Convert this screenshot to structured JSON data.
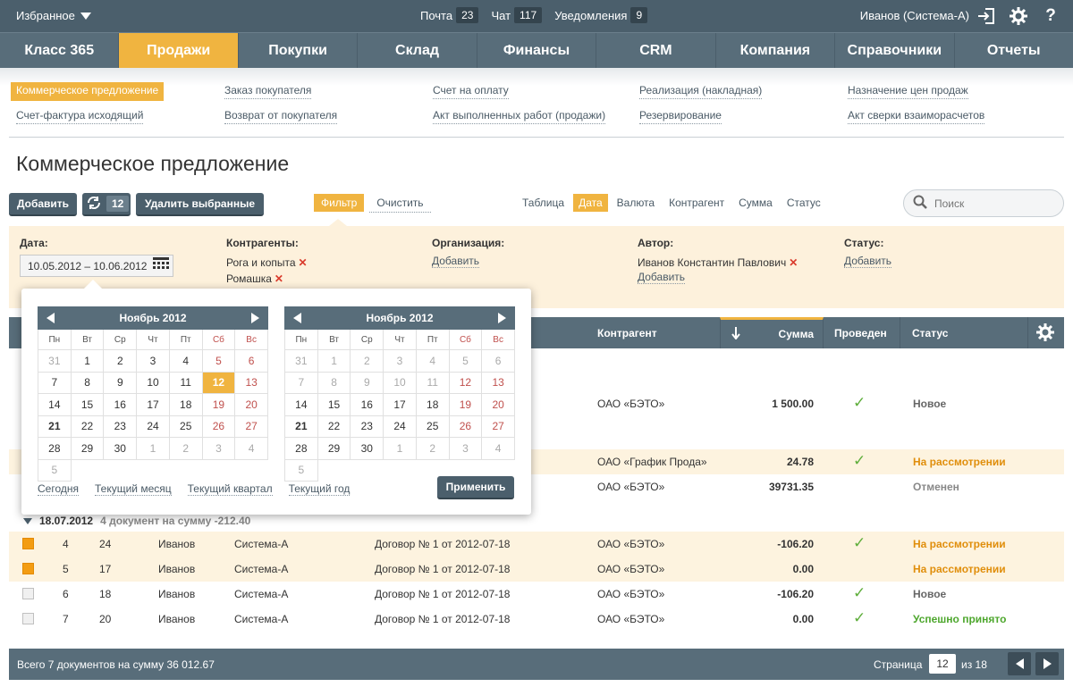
{
  "topbar": {
    "favorites": "Избранное",
    "mail_label": "Почта",
    "mail_count": "23",
    "chat_label": "Чат",
    "chat_count": "117",
    "notif_label": "Уведомления",
    "notif_count": "9",
    "user": "Иванов (Система-А)"
  },
  "nav": [
    "Класс 365",
    "Продажи",
    "Покупки",
    "Склад",
    "Финансы",
    "CRM",
    "Компания",
    "Справочники",
    "Отчеты"
  ],
  "subnav": [
    [
      "Коммерческое предложение",
      "Счет-фактура исходящий"
    ],
    [
      "Заказ покупателя",
      "Возврат от покупателя"
    ],
    [
      "Счет на оплату",
      "Акт выполненных работ (продажи)"
    ],
    [
      "Реализация (накладная)",
      "Резервирование"
    ],
    [
      "Назначение цен продаж",
      "Акт сверки взаиморасчетов"
    ]
  ],
  "page_title": "Коммерческое предложение",
  "toolbar": {
    "add": "Добавить",
    "refresh_count": "12",
    "delete": "Удалить выбранные"
  },
  "filter_tabs": {
    "filter": "Фильтр",
    "clear": "Очистить"
  },
  "view_tabs": [
    "Таблица",
    "Дата",
    "Валюта",
    "Контрагент",
    "Сумма",
    "Статус"
  ],
  "search": {
    "placeholder": "Поиск"
  },
  "filters": {
    "date_label": "Дата:",
    "date_value": "10.05.2012 – 10.06.2012",
    "contractors_label": "Контрагенты:",
    "contractor1": "Рога и копыта",
    "contractor2": "Ромашка",
    "org_label": "Организация:",
    "org_add": "Добавить",
    "author_label": "Автор:",
    "author_value": "Иванов Константин Павлович",
    "author_add": "Добавить",
    "status_label": "Статус:",
    "status_add": "Добавить"
  },
  "table_headers": {
    "contractor": "Контрагент",
    "sum": "Сумма",
    "posted": "Проведен",
    "status": "Статус"
  },
  "upper_rows": [
    {
      "contractor": "ОАО «БЭТО»",
      "sum": "1 500.00",
      "check": "✓",
      "status": "Новое"
    },
    {
      "contractor": "ОАО «График Прода»",
      "sum": "24.78",
      "check": "✓",
      "status": "На рассмотрении"
    },
    {
      "contractor": "ОАО «БЭТО»",
      "sum": "39731.35",
      "check": "",
      "status": "Отменен"
    }
  ],
  "group": {
    "date": "18.07.2012",
    "summary": "4 документ на сумму -212.40"
  },
  "rows": [
    {
      "n": "4",
      "num": "24",
      "author": "Иванов",
      "org": "Система-А",
      "contract": "Договор № 1 от 2012-07-18",
      "contractor": "ОАО «БЭТО»",
      "sum": "-106.20",
      "check": "✓",
      "status": "На рассмотрении"
    },
    {
      "n": "5",
      "num": "17",
      "author": "Иванов",
      "org": "Система-А",
      "contract": "Договор № 1 от 2012-07-18",
      "contractor": "ОАО «БЭТО»",
      "sum": "0.00",
      "check": "",
      "status": "На рассмотрении"
    },
    {
      "n": "6",
      "num": "18",
      "author": "Иванов",
      "org": "Система-А",
      "contract": "Договор № 1 от 2012-07-18",
      "contractor": "ОАО «БЭТО»",
      "sum": "-106.20",
      "check": "✓",
      "status": "Новое"
    },
    {
      "n": "7",
      "num": "20",
      "author": "Иванов",
      "org": "Система-А",
      "contract": "Договор № 1 от 2012-07-18",
      "contractor": "ОАО «БЭТО»",
      "sum": "0.00",
      "check": "✓",
      "status": "Успешно принято"
    }
  ],
  "footer": {
    "summary": "Всего 7 документов на сумму 36 012.67",
    "page_label": "Страница",
    "page": "12",
    "of": "из 18"
  },
  "calendar": {
    "month1": "Ноябрь 2012",
    "month2": "Ноябрь 2012",
    "dow": [
      "Пн",
      "Вт",
      "Ср",
      "Чт",
      "Пт",
      "Сб",
      "Вс"
    ],
    "m1_days": [
      "31",
      "1",
      "2",
      "3",
      "4",
      "5",
      "6",
      "7",
      "8",
      "9",
      "10",
      "11",
      "12",
      "13",
      "14",
      "15",
      "16",
      "17",
      "18",
      "19",
      "20",
      "21",
      "22",
      "23",
      "24",
      "25",
      "26",
      "27",
      "28",
      "29",
      "30",
      "1",
      "2",
      "3",
      "4",
      "5"
    ],
    "m2_days": [
      "31",
      "1",
      "2",
      "3",
      "4",
      "5",
      "6",
      "7",
      "8",
      "9",
      "10",
      "11",
      "12",
      "13",
      "14",
      "15",
      "16",
      "17",
      "18",
      "19",
      "20",
      "21",
      "22",
      "23",
      "24",
      "25",
      "26",
      "27",
      "28",
      "29",
      "30",
      "1",
      "2",
      "3",
      "4",
      "5"
    ],
    "links": [
      "Сегодня",
      "Текущий месяц",
      "Текущий квартал",
      "Текущий год"
    ],
    "apply": "Применить"
  }
}
